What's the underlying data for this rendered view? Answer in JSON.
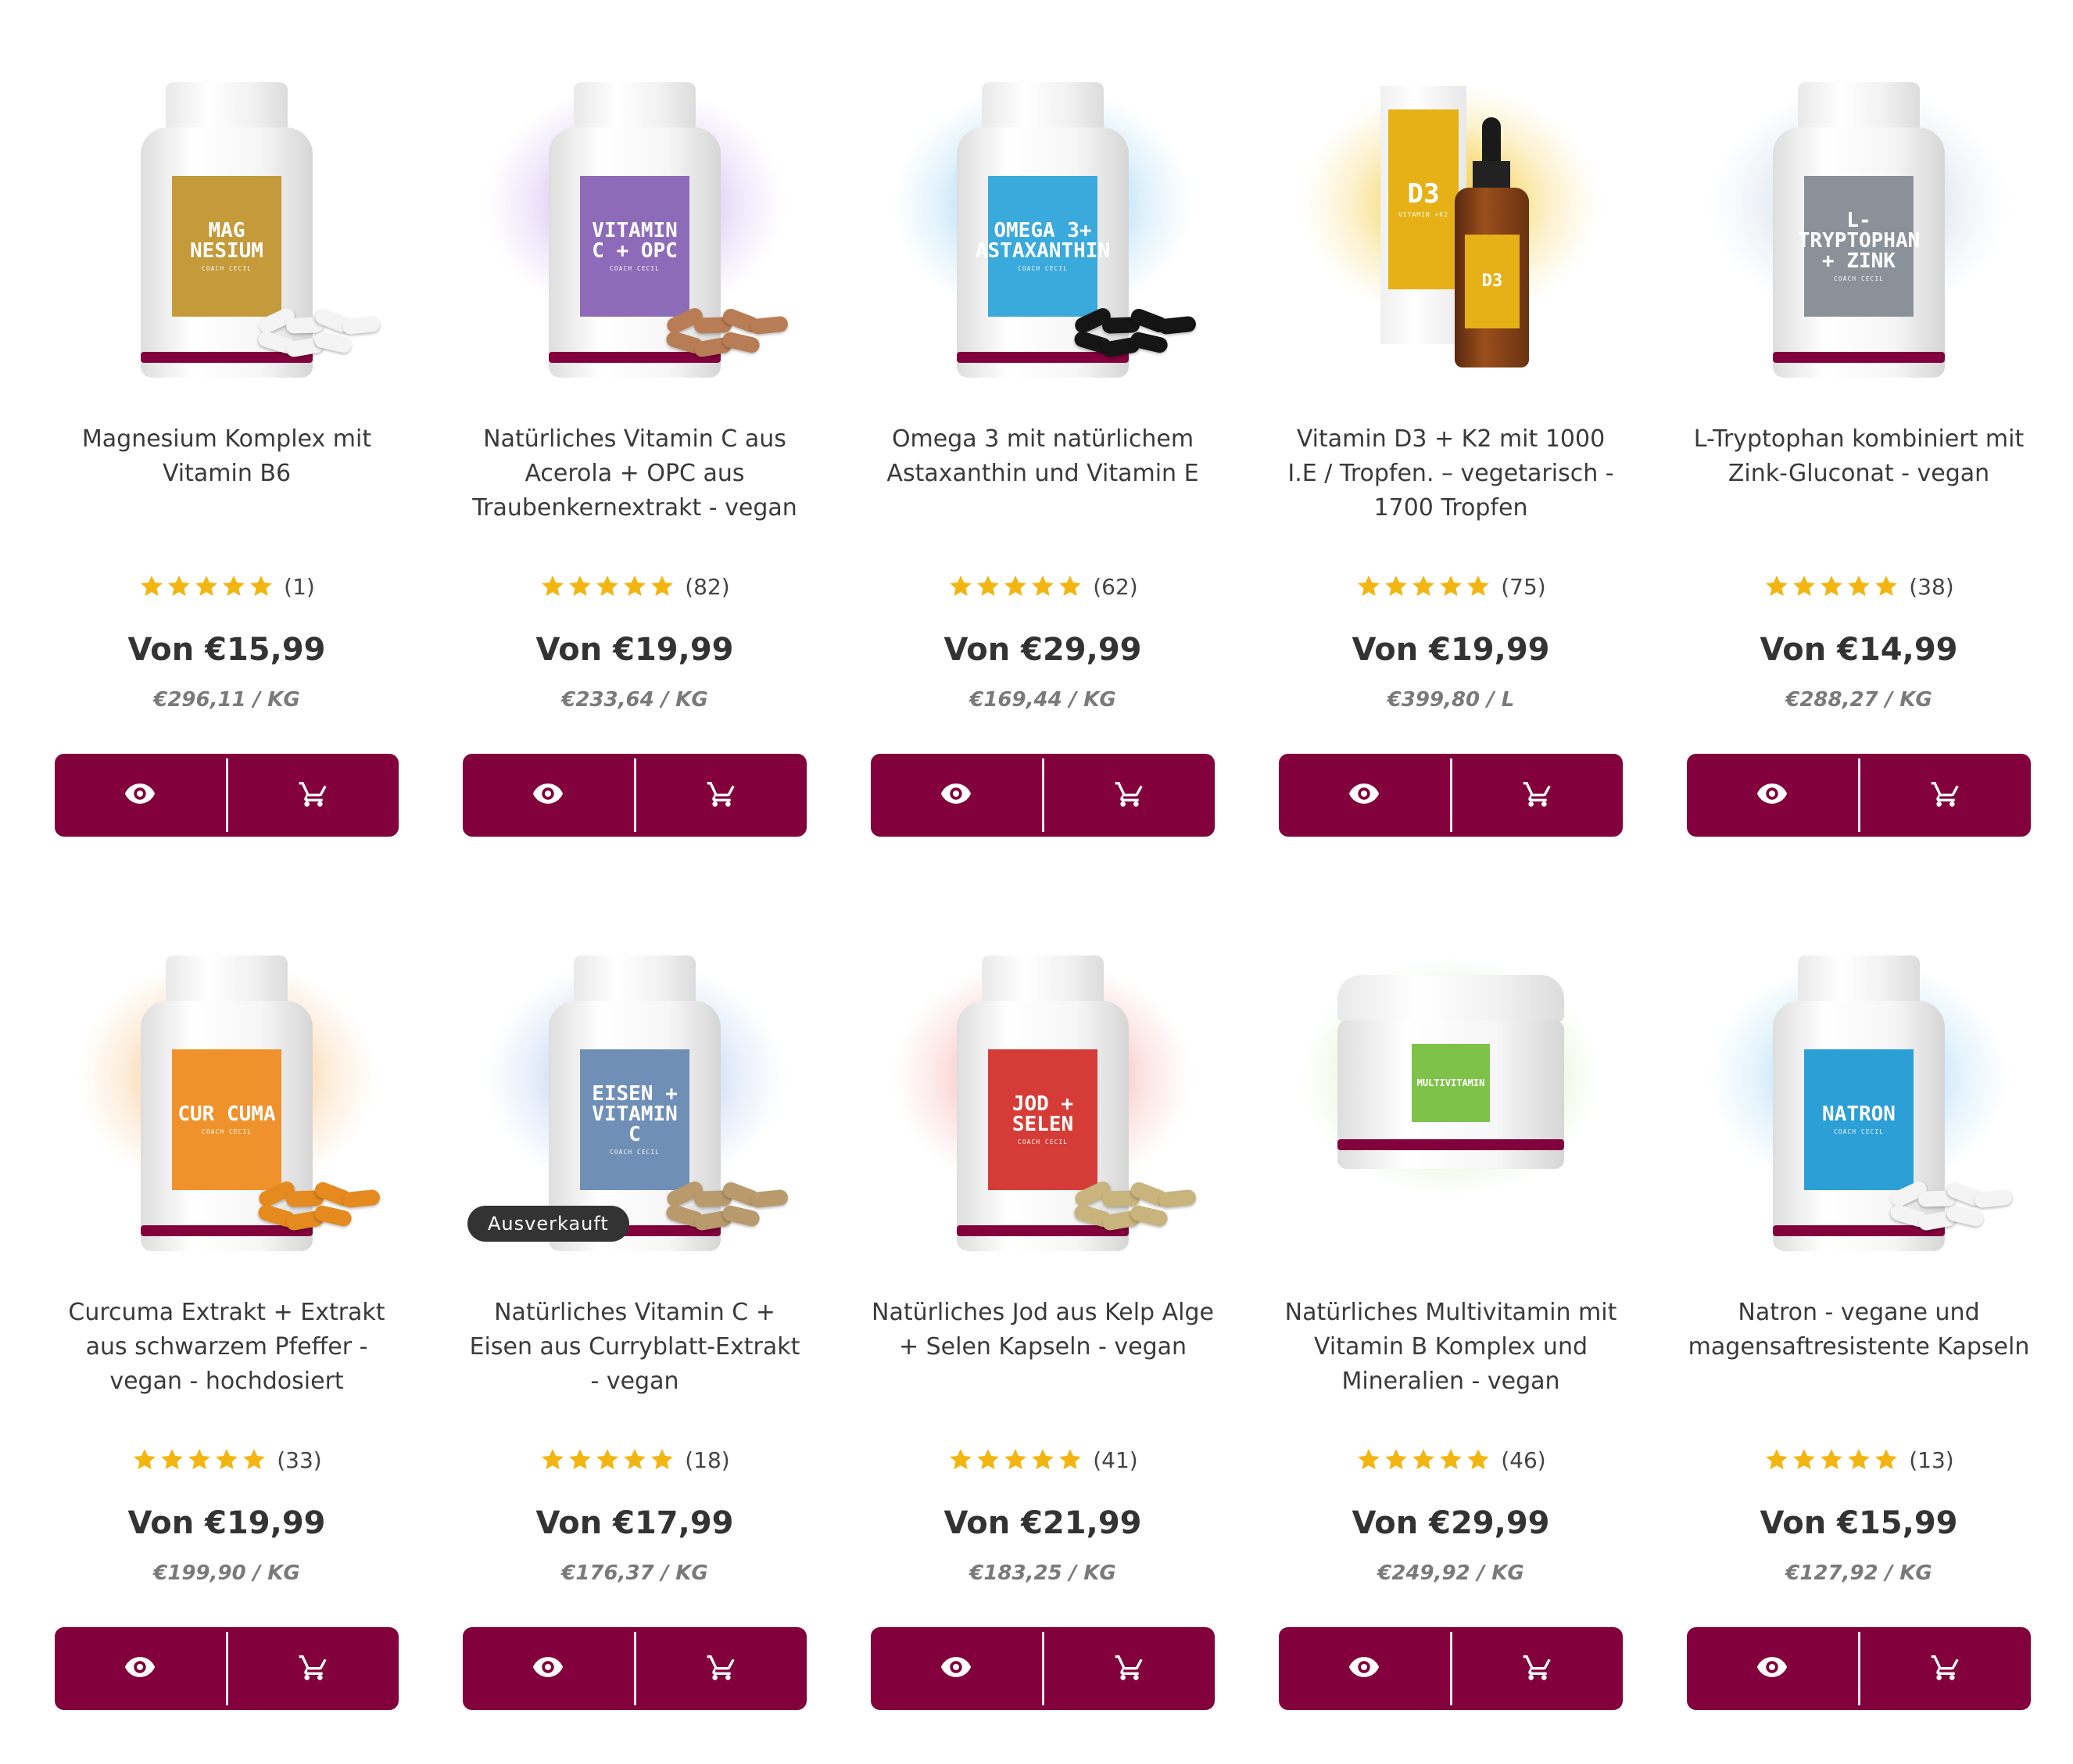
{
  "theme": {
    "accent": "#82003c",
    "star": "#f2b511",
    "badge": "#333333"
  },
  "labels": {
    "view_icon": "eye-icon",
    "cart_icon": "cart-icon"
  },
  "products": [
    {
      "title": "Magnesium Komplex mit Vitamin B6",
      "label_text": "MAG NESIUM",
      "label_color": "#c49a3a",
      "cloud_color": "",
      "capsule_color": "#f4f4f4",
      "rating": 5,
      "reviews": "(1)",
      "price": "Von €15,99",
      "unit_price": "€296,11 / KG"
    },
    {
      "title": "Natürliches Vitamin C aus Acerola + OPC aus Traubenkernextrakt - vegan",
      "label_text": "VITAMIN C + OPC",
      "label_color": "#8e6bb8",
      "cloud_color": "#c8a8ee",
      "capsule_color": "#b97d55",
      "rating": 5,
      "reviews": "(82)",
      "price": "Von €19,99",
      "unit_price": "€233,64 / KG"
    },
    {
      "title": "Omega 3 mit natürlichem Astaxanthin und Vitamin E",
      "label_text": "OMEGA 3+ ASTAXANTHIN",
      "label_color": "#3aa9db",
      "cloud_color": "#8fd0f2",
      "capsule_color": "#151515",
      "rating": 5,
      "reviews": "(62)",
      "price": "Von €29,99",
      "unit_price": "€169,44 / KG"
    },
    {
      "title": "Vitamin D3 + K2 mit 1000 I.E / Tropfen. – vegetarisch - 1700 Tropfen",
      "label_text": "VITAMIN D3 +K2",
      "label_color": "#e6b117",
      "cloud_color": "#f7d35a",
      "capsule_color": "",
      "rating": 5,
      "reviews": "(75)",
      "price": "Von €19,99",
      "unit_price": "€399,80 / L"
    },
    {
      "title": "L-Tryptophan kombiniert mit Zink-Gluconat - vegan",
      "label_text": "L-TRYPTOPHAN + ZINK",
      "label_color": "#8b9198",
      "cloud_color": "#c9d6e8",
      "capsule_color": "",
      "rating": 5,
      "reviews": "(38)",
      "price": "Von €14,99",
      "unit_price": "€288,27 / KG"
    },
    {
      "title": "Curcuma Extrakt + Extrakt aus schwarzem Pfeffer - vegan - hochdosiert",
      "label_text": "CUR CUMA",
      "label_color": "#f0922b",
      "cloud_color": "#f8bf7a",
      "capsule_color": "#e58a1e",
      "rating": 5,
      "reviews": "(33)",
      "price": "Von €19,99",
      "unit_price": "€199,90 / KG"
    },
    {
      "title": "Natürliches Vitamin C + Eisen aus Curryblatt-Extrakt - vegan",
      "label_text": "EISEN + VITAMIN C",
      "label_color": "#6f8fb7",
      "cloud_color": "#a9c4ef",
      "capsule_color": "#b99a6c",
      "rating": 5,
      "reviews": "(18)",
      "price": "Von €17,99",
      "unit_price": "€176,37 / KG",
      "badge": "Ausverkauft"
    },
    {
      "title": "Natürliches Jod aus Kelp Alge + Selen Kapseln - vegan",
      "label_text": "JOD + SELEN",
      "label_color": "#d63c37",
      "cloud_color": "#f6a4a0",
      "capsule_color": "#c8b47c",
      "rating": 5,
      "reviews": "(41)",
      "price": "Von €21,99",
      "unit_price": "€183,25 / KG"
    },
    {
      "title": "Natürliches Multivitamin mit Vitamin B Komplex und Mineralien - vegan",
      "label_text": "MULTIVITAMIN",
      "label_color": "#7fc24a",
      "cloud_color": "#bfe69a",
      "capsule_color": "",
      "rating": 5,
      "reviews": "(46)",
      "price": "Von €29,99",
      "unit_price": "€249,92 / KG"
    },
    {
      "title": "Natron - vegane und magensaftresistente Kapseln",
      "label_text": "NATRON",
      "label_color": "#2b9fd6",
      "cloud_color": "#9ed6f4",
      "capsule_color": "#f4f4f4",
      "rating": 5,
      "reviews": "(13)",
      "price": "Von €15,99",
      "unit_price": "€127,92 / KG"
    }
  ]
}
